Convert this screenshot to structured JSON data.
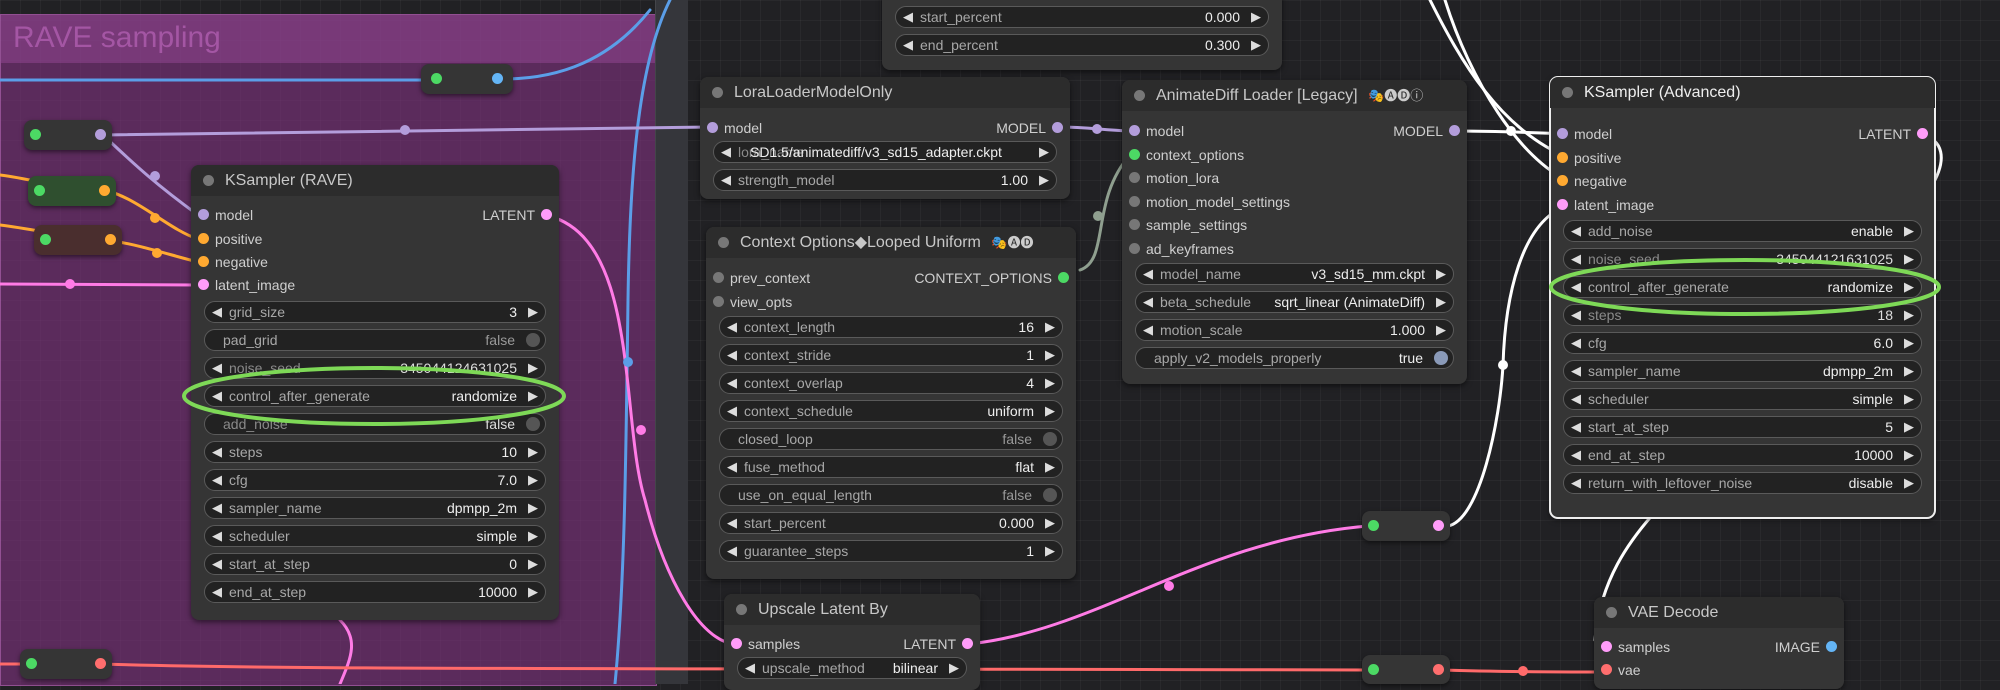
{
  "colors": {
    "model": "#b39ddb",
    "conditioning": "#ffa931",
    "latent": "#ff9cf9",
    "image": "#64b5f6",
    "vae": "#ff6e6e",
    "context": "#4cd964",
    "link_model": "#b39ddb",
    "link_latent": "#ff7be6",
    "link_blue": "#5b9ee8",
    "link_red": "#ff6a6a",
    "link_white": "#ffffff",
    "link_orange": "#ffa931",
    "highlight": "#7ed957"
  },
  "group": {
    "title": "RAVE sampling"
  },
  "top_partial": {
    "widgets": [
      {
        "label": "start_percent",
        "value": "0.000"
      },
      {
        "label": "end_percent",
        "value": "0.300"
      }
    ]
  },
  "lora": {
    "title": "LoraLoaderModelOnly",
    "input": "model",
    "output": "MODEL",
    "widgets": [
      {
        "label": "lora_name",
        "value": "SD1.5/animatediff/v3_sd15_adapter.ckpt"
      },
      {
        "label": "strength_model",
        "value": "1.00"
      }
    ]
  },
  "animatediff": {
    "title": "AnimateDiff Loader [Legacy]",
    "badges": "🎭🅐🅓ⓘ",
    "inputs": [
      "model",
      "context_options",
      "motion_lora",
      "motion_model_settings",
      "sample_settings",
      "ad_keyframes"
    ],
    "output": "MODEL",
    "widgets": [
      {
        "label": "model_name",
        "value": "v3_sd15_mm.ckpt"
      },
      {
        "label": "beta_schedule",
        "value": "sqrt_linear (AnimateDiff)"
      },
      {
        "label": "motion_scale",
        "value": "1.000"
      }
    ],
    "toggle": {
      "label": "apply_v2_models_properly",
      "value": "true"
    }
  },
  "context": {
    "title": "Context Options◆Looped Uniform",
    "badges": "🎭🅐🅓",
    "inputs": [
      "prev_context",
      "view_opts"
    ],
    "output": "CONTEXT_OPTIONS",
    "widgets": [
      {
        "kind": "combo",
        "label": "context_length",
        "value": "16"
      },
      {
        "kind": "combo",
        "label": "context_stride",
        "value": "1"
      },
      {
        "kind": "combo",
        "label": "context_overlap",
        "value": "4"
      },
      {
        "kind": "combo",
        "label": "context_schedule",
        "value": "uniform"
      },
      {
        "kind": "toggle",
        "label": "closed_loop",
        "value": "false"
      },
      {
        "kind": "combo",
        "label": "fuse_method",
        "value": "flat"
      },
      {
        "kind": "toggle",
        "label": "use_on_equal_length",
        "value": "false"
      },
      {
        "kind": "combo",
        "label": "start_percent",
        "value": "0.000"
      },
      {
        "kind": "combo",
        "label": "guarantee_steps",
        "value": "1"
      }
    ]
  },
  "rave": {
    "title": "KSampler (RAVE)",
    "inputs": [
      "model",
      "positive",
      "negative",
      "latent_image"
    ],
    "output": "LATENT",
    "widgets": [
      {
        "kind": "combo",
        "label": "grid_size",
        "value": "3"
      },
      {
        "kind": "toggle",
        "label": "pad_grid",
        "value": "false"
      },
      {
        "kind": "overlap",
        "label": "noise_seed",
        "value": "345044124631025"
      },
      {
        "kind": "combo",
        "label": "control_after_generate",
        "value": "randomize"
      },
      {
        "kind": "toggle-overlap",
        "label": "add_noise",
        "value": "false"
      },
      {
        "kind": "combo",
        "label": "steps",
        "value": "10"
      },
      {
        "kind": "combo",
        "label": "cfg",
        "value": "7.0"
      },
      {
        "kind": "combo",
        "label": "sampler_name",
        "value": "dpmpp_2m"
      },
      {
        "kind": "combo",
        "label": "scheduler",
        "value": "simple"
      },
      {
        "kind": "combo",
        "label": "start_at_step",
        "value": "0"
      },
      {
        "kind": "combo",
        "label": "end_at_step",
        "value": "10000"
      }
    ]
  },
  "ksadv": {
    "title": "KSampler (Advanced)",
    "inputs": [
      "model",
      "positive",
      "negative",
      "latent_image"
    ],
    "output": "LATENT",
    "widgets": [
      {
        "kind": "combo",
        "label": "add_noise",
        "value": "enable"
      },
      {
        "kind": "overlap",
        "label": "noise_seed",
        "value": "345044121631025"
      },
      {
        "kind": "combo",
        "label": "control_after_generate",
        "value": "randomize"
      },
      {
        "kind": "overlap",
        "label": "steps",
        "value": "18"
      },
      {
        "kind": "combo",
        "label": "cfg",
        "value": "6.0"
      },
      {
        "kind": "combo",
        "label": "sampler_name",
        "value": "dpmpp_2m"
      },
      {
        "kind": "combo",
        "label": "scheduler",
        "value": "simple"
      },
      {
        "kind": "combo",
        "label": "start_at_step",
        "value": "5"
      },
      {
        "kind": "combo",
        "label": "end_at_step",
        "value": "10000"
      },
      {
        "kind": "combo",
        "label": "return_with_leftover_noise",
        "value": "disable"
      }
    ]
  },
  "upscale": {
    "title": "Upscale Latent By",
    "input": "samples",
    "output": "LATENT",
    "widget": {
      "label": "upscale_method",
      "value": "bilinear"
    }
  },
  "vaedecode": {
    "title": "VAE Decode",
    "inputs": [
      "samples",
      "vae"
    ],
    "output": "IMAGE"
  }
}
